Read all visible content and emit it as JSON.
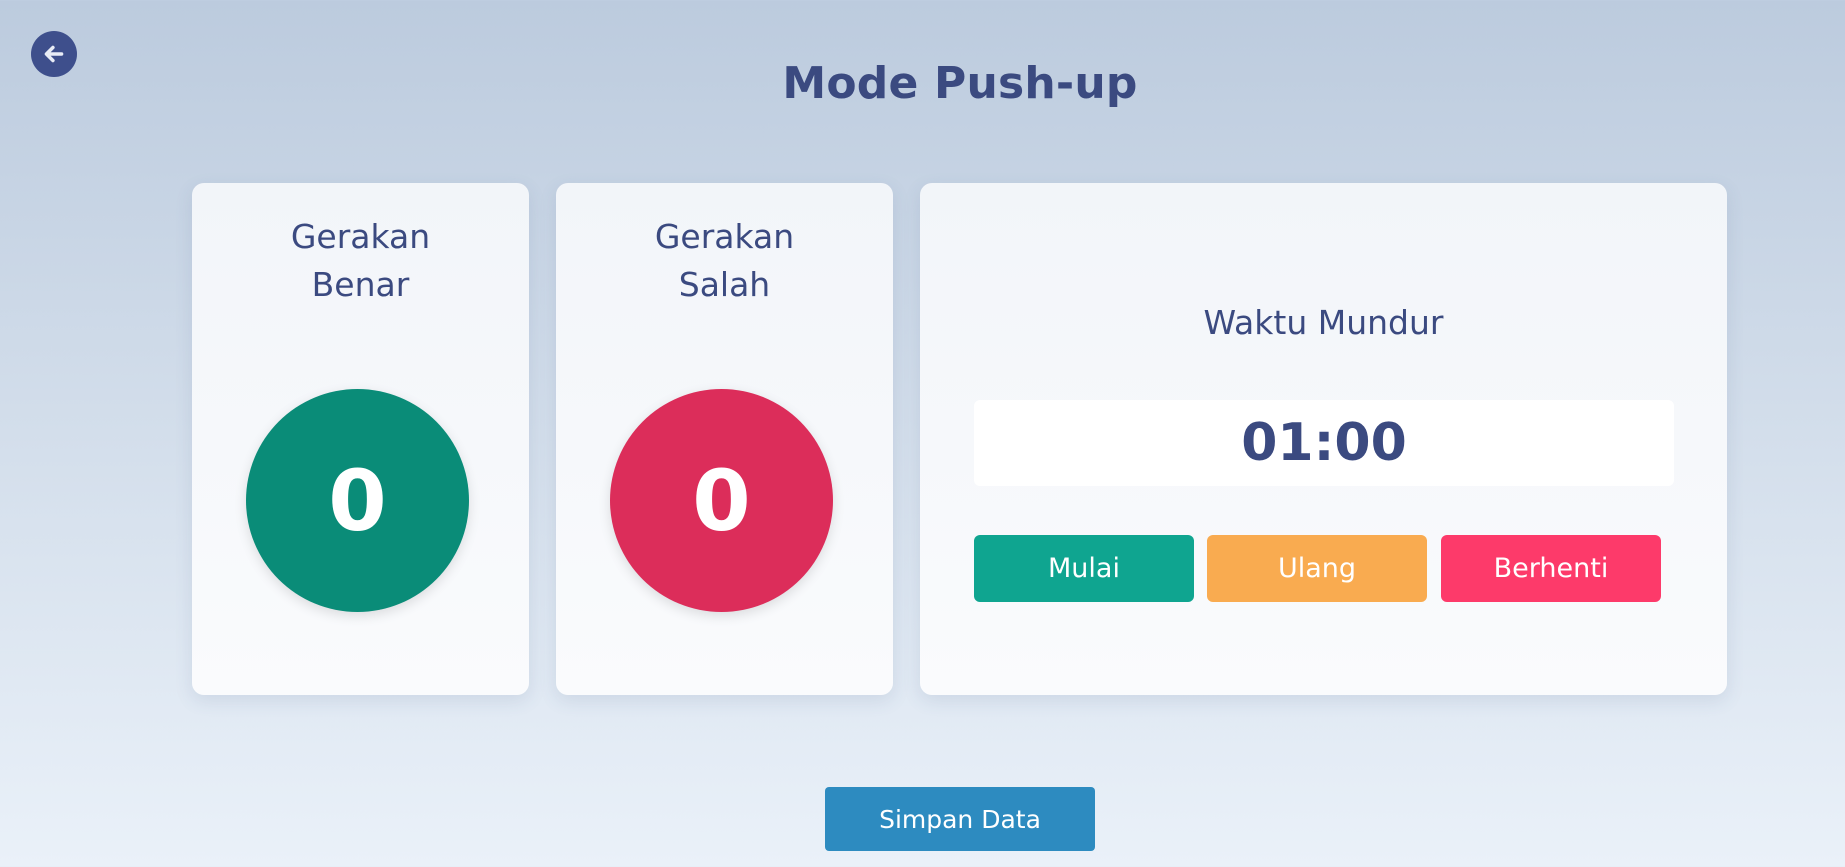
{
  "header": {
    "title": "Mode Push-up",
    "back_icon": "arrow-left-icon"
  },
  "cards": {
    "benar": {
      "label": "Gerakan\nBenar",
      "count": "0",
      "color": "#0a8c78"
    },
    "salah": {
      "label": "Gerakan\nSalah",
      "count": "0",
      "color": "#dc2d5a"
    }
  },
  "timer": {
    "label": "Waktu Mundur",
    "value": "01:00",
    "buttons": {
      "start": "Mulai",
      "reset": "Ulang",
      "stop": "Berhenti"
    },
    "colors": {
      "start": "#0fa590",
      "reset": "#f9ab50",
      "stop": "#fd3a6a"
    }
  },
  "footer": {
    "save_label": "Simpan Data",
    "save_color": "#2d8bc0"
  }
}
